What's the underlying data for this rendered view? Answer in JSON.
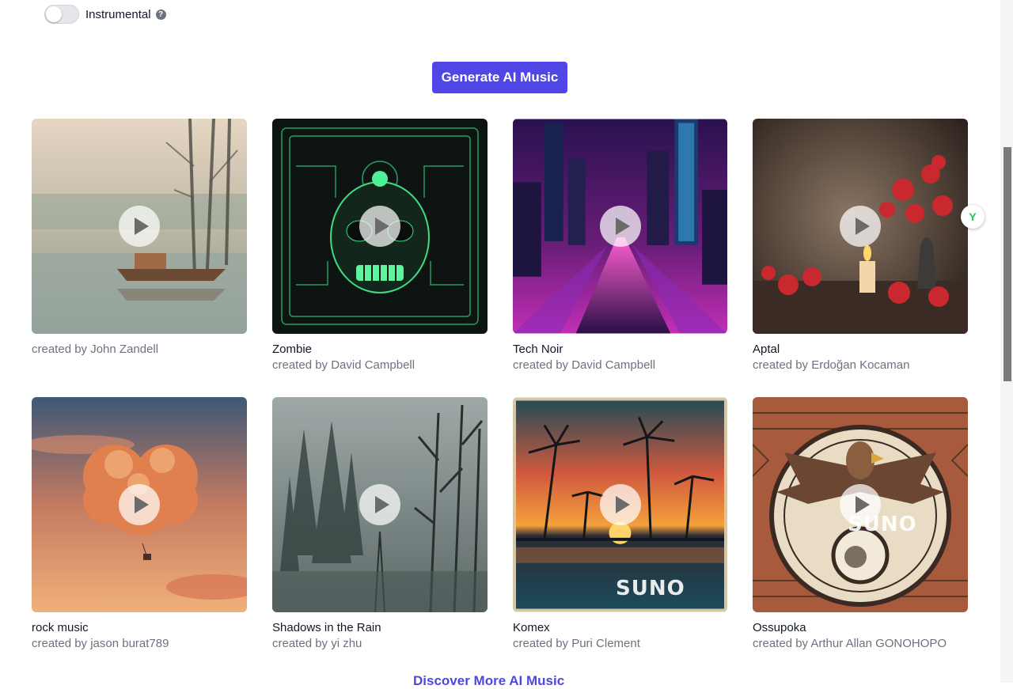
{
  "controls": {
    "instrumental_label": "Instrumental",
    "instrumental_on": false,
    "help_glyph": "?"
  },
  "generate_button": "Generate AI Music",
  "discover_link": "Discover More AI Music",
  "watermark": "SUNO",
  "extension_glyph": "Y",
  "cards": [
    {
      "title": "",
      "creator": "created by John Zandell",
      "art": "misty-lake-boat"
    },
    {
      "title": "Zombie",
      "creator": "created by David Campbell",
      "art": "green-circuit-skull"
    },
    {
      "title": "Tech Noir",
      "creator": "created by David Campbell",
      "art": "neon-city-street"
    },
    {
      "title": "Aptal",
      "creator": "created by Erdoğan Kocaman",
      "art": "candle-red-flowers"
    },
    {
      "title": "rock music",
      "creator": "created by jason burat789",
      "art": "heart-cloud-balloon"
    },
    {
      "title": "Shadows in the Rain",
      "creator": "created by yi zhu",
      "art": "foggy-forest"
    },
    {
      "title": "Komex",
      "creator": "created by Puri Clement",
      "art": "palm-sunset"
    },
    {
      "title": "Ossupoka",
      "creator": "created by Arthur Allan GONOHOPO",
      "art": "tribal-eagle"
    }
  ]
}
